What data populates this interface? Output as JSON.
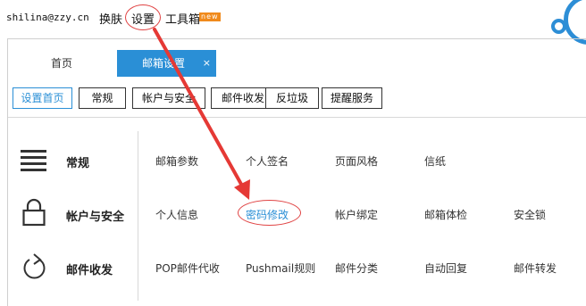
{
  "header": {
    "user_email": "shilina@zzy.cn",
    "links": {
      "skin": "换肤",
      "settings": "设置",
      "tools": "工具箱"
    },
    "new_badge": "new"
  },
  "tabs": {
    "home": "首页",
    "settings": "邮箱设置",
    "close": "×"
  },
  "subtabs": [
    "设置首页",
    "常规",
    "帐户与安全",
    "邮件收发",
    "反垃圾",
    "提醒服务"
  ],
  "categories": [
    {
      "label": "常规",
      "icon": "menu-lines-icon",
      "items": [
        "邮箱参数",
        "个人签名",
        "页面风格",
        "信纸"
      ]
    },
    {
      "label": "帐户与安全",
      "icon": "lock-icon",
      "items": [
        "个人信息",
        "密码修改",
        "帐户绑定",
        "邮箱体检",
        "安全锁"
      ]
    },
    {
      "label": "邮件收发",
      "icon": "refresh-icon",
      "items": [
        "POP邮件代收",
        "Pushmail规则",
        "邮件分类",
        "自动回复",
        "邮件转发"
      ]
    }
  ],
  "colors": {
    "accent": "#2a8fd6",
    "annotation": "#e04343",
    "badge": "#f08a1c"
  }
}
